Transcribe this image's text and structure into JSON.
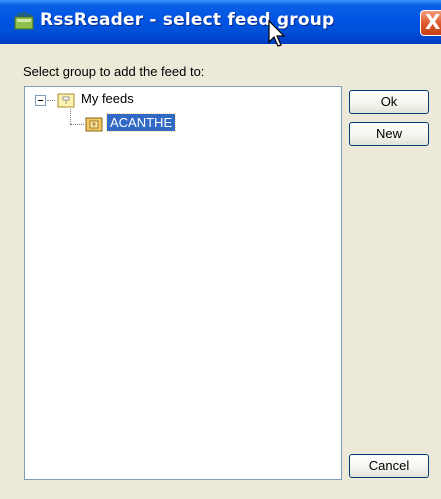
{
  "window": {
    "title": "RssReader - select feed group",
    "close_glyph": "X",
    "title_icon": "rss-app-icon",
    "accent_color": "#0054e3",
    "close_color": "#e05a2c"
  },
  "dialog": {
    "prompt": "Select group to add the feed to:"
  },
  "tree": {
    "root": {
      "label": "My feeds",
      "expanded": true,
      "expander_glyph": "−",
      "icon": "folder-icon",
      "children": [
        {
          "label": "ACANTHE",
          "selected": true,
          "icon": "folder-icon",
          "selection_color": "#316ac5"
        }
      ]
    }
  },
  "buttons": {
    "ok_label": "Ok",
    "new_label": "New",
    "cancel_label": "Cancel"
  }
}
